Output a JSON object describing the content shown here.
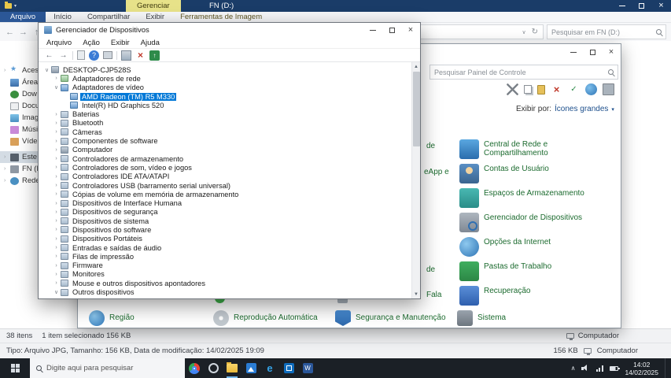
{
  "colors": {
    "accent": "#0078d7",
    "navy": "#1a3c68",
    "ctx_tab": "#e7e289",
    "ribbon_file": "#2b5797",
    "cp_link": "#1c6b2f",
    "taskbar": "#1b2026",
    "status": "#f1f2f4"
  },
  "explorer": {
    "contextual_tab": "Gerenciar",
    "window_title": "FN (D:)",
    "ribbon_tabs": [
      {
        "label": "Arquivo",
        "style": "accent"
      },
      {
        "label": "Início",
        "style": "normal"
      },
      {
        "label": "Compartilhar",
        "style": "normal"
      },
      {
        "label": "Exibir",
        "style": "normal"
      },
      {
        "label": "Ferramentas de Imagem",
        "style": "contextual"
      }
    ],
    "search_placeholder": "Pesquisar em FN (D:)",
    "sidebar_items": [
      {
        "label": "Acess",
        "icon": "quick-access-star",
        "expander": true
      },
      {
        "label": "Área",
        "icon": "desktop",
        "expander": false
      },
      {
        "label": "Dow",
        "icon": "downloads",
        "expander": false
      },
      {
        "label": "Docu",
        "icon": "documents",
        "expander": false
      },
      {
        "label": "Imag",
        "icon": "pictures",
        "expander": false
      },
      {
        "label": "Músi",
        "icon": "music",
        "expander": false
      },
      {
        "label": "Víde",
        "icon": "videos",
        "expander": false
      },
      {
        "label": "Este C",
        "icon": "this-pc",
        "expander": true,
        "selected": true,
        "gap": true
      },
      {
        "label": "FN (D:",
        "icon": "usb-drive",
        "expander": true
      },
      {
        "label": "Rede",
        "icon": "network",
        "expander": true
      }
    ],
    "status": {
      "items_count": "38 itens",
      "selection": "1 item selecionado 156 KB",
      "file_details": "Tipo: Arquivo JPG, Tamanho: 156 KB, Data de modificação: 14/02/2025 19:09",
      "file_size": "156 KB",
      "location": "Computador"
    }
  },
  "device_manager": {
    "window_title": "Gerenciador de Dispositivos",
    "menu_items": [
      "Arquivo",
      "Ação",
      "Exibir",
      "Ajuda"
    ],
    "toolbar_icons": [
      "back",
      "forward",
      "separator",
      "export-list",
      "help",
      "properties",
      "separator",
      "scan-hardware",
      "uninstall-device",
      "update-driver"
    ],
    "tree": [
      {
        "label": "DESKTOP-CJP528S",
        "level": 0,
        "expander": "open",
        "icon": "computer"
      },
      {
        "label": "Adaptadores de rede",
        "level": 1,
        "expander": "closed",
        "icon": "network-adapter"
      },
      {
        "label": "Adaptadores de vídeo",
        "level": 1,
        "expander": "open",
        "icon": "display-adapter"
      },
      {
        "label": "AMD Radeon (TM) R5 M330",
        "level": 2,
        "expander": "",
        "icon": "display-adapter",
        "selected": true
      },
      {
        "label": "Intel(R) HD Graphics 520",
        "level": 2,
        "expander": "",
        "icon": "display-adapter"
      },
      {
        "label": "Baterias",
        "level": 1,
        "expander": "closed",
        "icon": "battery"
      },
      {
        "label": "Bluetooth",
        "level": 1,
        "expander": "closed",
        "icon": "bluetooth"
      },
      {
        "label": "Câmeras",
        "level": 1,
        "expander": "closed",
        "icon": "camera"
      },
      {
        "label": "Componentes de software",
        "level": 1,
        "expander": "closed",
        "icon": "software-component"
      },
      {
        "label": "Computador",
        "level": 1,
        "expander": "closed",
        "icon": "computer"
      },
      {
        "label": "Controladores de armazenamento",
        "level": 1,
        "expander": "closed",
        "icon": "storage-controller"
      },
      {
        "label": "Controladores de som, vídeo e jogos",
        "level": 1,
        "expander": "closed",
        "icon": "sound-controller"
      },
      {
        "label": "Controladores IDE ATA/ATAPI",
        "level": 1,
        "expander": "closed",
        "icon": "ide-controller"
      },
      {
        "label": "Controladores USB (barramento serial universal)",
        "level": 1,
        "expander": "closed",
        "icon": "usb-controller"
      },
      {
        "label": "Cópias de volume em memória de armazenamento",
        "level": 1,
        "expander": "closed",
        "icon": "storage-volume"
      },
      {
        "label": "Dispositivos de Interface Humana",
        "level": 1,
        "expander": "closed",
        "icon": "hid-device"
      },
      {
        "label": "Dispositivos de segurança",
        "level": 1,
        "expander": "closed",
        "icon": "security-device"
      },
      {
        "label": "Dispositivos de sistema",
        "level": 1,
        "expander": "closed",
        "icon": "system-device"
      },
      {
        "label": "Dispositivos do software",
        "level": 1,
        "expander": "closed",
        "icon": "software-device"
      },
      {
        "label": "Dispositivos Portáteis",
        "level": 1,
        "expander": "closed",
        "icon": "portable-device"
      },
      {
        "label": "Entradas e saídas de áudio",
        "level": 1,
        "expander": "closed",
        "icon": "audio-device"
      },
      {
        "label": "Filas de impressão",
        "level": 1,
        "expander": "closed",
        "icon": "print-queue"
      },
      {
        "label": "Firmware",
        "level": 1,
        "expander": "closed",
        "icon": "firmware"
      },
      {
        "label": "Monitores",
        "level": 1,
        "expander": "closed",
        "icon": "monitor"
      },
      {
        "label": "Mouse e outros dispositivos apontadores",
        "level": 1,
        "expander": "closed",
        "icon": "mouse"
      },
      {
        "label": "Outros dispositivos",
        "level": 1,
        "expander": "open",
        "icon": "other-device"
      }
    ]
  },
  "control_panel": {
    "search_placeholder": "Pesquisar Painel de Controle",
    "toolbar_icons": [
      "cut",
      "copy",
      "paste",
      "delete",
      "check",
      "globe",
      "monitor"
    ],
    "view_by_label": "Exibir por:",
    "view_by_value": "Ícones grandes",
    "right_column_items": [
      {
        "label": "Central de Rede e Compartilhamento",
        "icon": "network-sharing-center"
      },
      {
        "label": "Contas de Usuário",
        "icon": "user-accounts"
      },
      {
        "label": "Espaços de Armazenamento",
        "icon": "storage-spaces"
      },
      {
        "label": "Gerenciador de Dispositivos",
        "icon": "device-manager"
      },
      {
        "label": "Opções da Internet",
        "icon": "internet-options"
      },
      {
        "label": "Pastas de Trabalho",
        "icon": "work-folders"
      },
      {
        "label": "Recuperação",
        "icon": "recovery"
      }
    ],
    "bottom_row_items": [
      {
        "label": "Região",
        "icon": "region"
      },
      {
        "label": "Reprodução Automática",
        "icon": "autoplay"
      },
      {
        "label": "Segurança e Manutenção",
        "icon": "security-maintenance"
      },
      {
        "label": "Sistema",
        "icon": "system"
      }
    ],
    "partial_text_fragments": [
      "de",
      "eApp e",
      "de",
      "Fala"
    ],
    "status_location": "Computador"
  },
  "taskbar": {
    "search_placeholder": "Digite aqui para pesquisar",
    "app_icons": [
      "chrome",
      "cortana",
      "file-explorer",
      "photos",
      "edge",
      "store",
      "word"
    ],
    "tray_icons": [
      "volume",
      "network",
      "battery"
    ],
    "clock_time": "14:02",
    "clock_date": "14/02/2025"
  }
}
